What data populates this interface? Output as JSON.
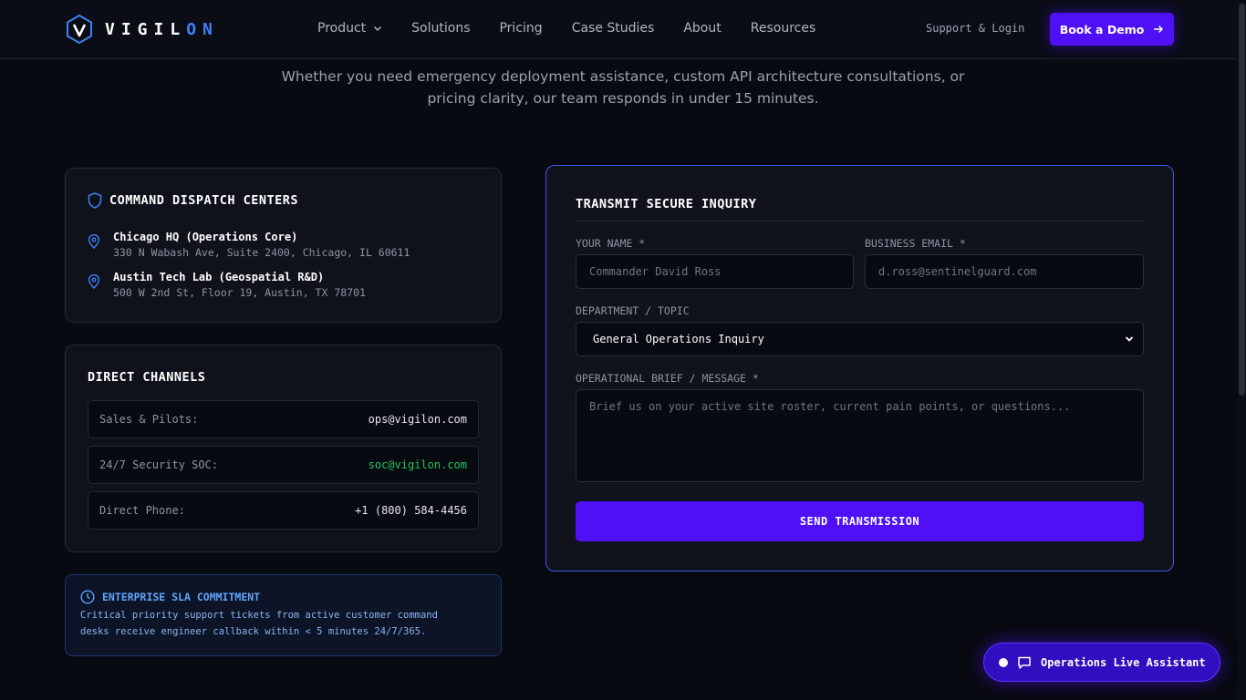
{
  "header": {
    "logo_main": "VIGIL",
    "logo_accent": "ON",
    "nav": [
      "Product",
      "Solutions",
      "Pricing",
      "Case Studies",
      "About",
      "Resources"
    ],
    "support_login": "Support & Login",
    "book_demo": "Book a Demo"
  },
  "intro": {
    "line1": "Whether you need emergency deployment assistance, custom API architecture consultations, or",
    "line2": "pricing clarity, our team responds in under 15 minutes."
  },
  "dispatch": {
    "title": "COMMAND DISPATCH CENTERS",
    "locations": [
      {
        "name": "Chicago HQ (Operations Core)",
        "address": "330 N Wabash Ave, Suite 2400, Chicago, IL 60611"
      },
      {
        "name": "Austin Tech Lab (Geospatial R&D)",
        "address": "500 W 2nd St, Floor 19, Austin, TX 78701"
      }
    ]
  },
  "channels": {
    "title": "DIRECT CHANNELS",
    "rows": [
      {
        "label": "Sales & Pilots:",
        "value": "ops@vigilon.com"
      },
      {
        "label": "24/7 Security SOC:",
        "value": "soc@vigilon.com"
      },
      {
        "label": "Direct Phone:",
        "value": "+1 (800) 584-4456"
      }
    ]
  },
  "sla": {
    "title": "ENTERPRISE SLA COMMITMENT",
    "line1": "Critical priority support tickets from active customer command",
    "line2": "desks receive engineer callback within < 5 minutes 24/7/365."
  },
  "form": {
    "title": "TRANSMIT SECURE INQUIRY",
    "name_label": "YOUR NAME *",
    "name_placeholder": "Commander David Ross",
    "email_label": "BUSINESS EMAIL *",
    "email_placeholder": "d.ross@sentinelguard.com",
    "department_label": "DEPARTMENT / TOPIC",
    "department_value": "General Operations Inquiry",
    "message_label": "OPERATIONAL BRIEF / MESSAGE *",
    "message_placeholder": "Brief us on your active site roster, current pain points, or questions...",
    "send_label": "SEND TRANSMISSION"
  },
  "assistant": {
    "label": "Operations Live Assistant"
  },
  "colors": {
    "accent": "#4f10f5",
    "link_blue": "#3b82f6",
    "soc_green": "#22c55e"
  }
}
